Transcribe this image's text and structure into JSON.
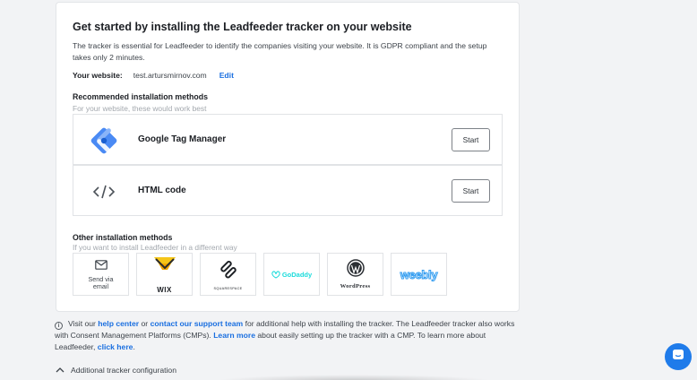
{
  "card": {
    "title": "Get started by installing the Leadfeeder tracker on your website",
    "description": "The tracker is essential for Leadfeeder to identify the companies visiting your website. It is GDPR compliant and the setup takes only 2 minutes.",
    "website_label": "Your website:",
    "website_value": "test.artursmirnov.com",
    "edit_label": "Edit"
  },
  "recommended": {
    "title": "Recommended installation methods",
    "subtitle": "For your website, these would work best",
    "methods": [
      {
        "label": "Google Tag Manager",
        "icon": "google-tag-manager-icon",
        "button": "Start"
      },
      {
        "label": "HTML code",
        "icon": "code-icon",
        "button": "Start"
      }
    ]
  },
  "other": {
    "title": "Other installation methods",
    "subtitle": "If you want to install Leadfeeder in a different way",
    "tiles": [
      {
        "label": "Send via email",
        "icon": "email-icon"
      },
      {
        "label": "WIX",
        "icon": "wix-logo"
      },
      {
        "label": "SQUARESPACE",
        "icon": "squarespace-logo"
      },
      {
        "label": "GoDaddy",
        "icon": "godaddy-logo"
      },
      {
        "label": "WordPress",
        "icon": "wordpress-logo"
      },
      {
        "label": "weebly",
        "icon": "weebly-logo"
      }
    ]
  },
  "info": {
    "t1": "Visit our ",
    "help_center": "help center",
    "t2": " or ",
    "support": "contact our support team",
    "t3": " for additional help with installing the tracker. The Leadfeeder tracker also works with Consent Management Platforms (CMPs). ",
    "learn_more": "Learn more",
    "t4": " about easily setting up the tracker with a CMP. To learn more about Leadfeeder, ",
    "click_here": "click here",
    "t5": "."
  },
  "config": {
    "label": "Additional tracker configuration"
  },
  "colors": {
    "link": "#1a6fe0",
    "gtm_blue": "#4a8af4",
    "chat": "#1f7bea",
    "godaddy": "#1bdbdb",
    "weebly": "#2f9bf0"
  }
}
